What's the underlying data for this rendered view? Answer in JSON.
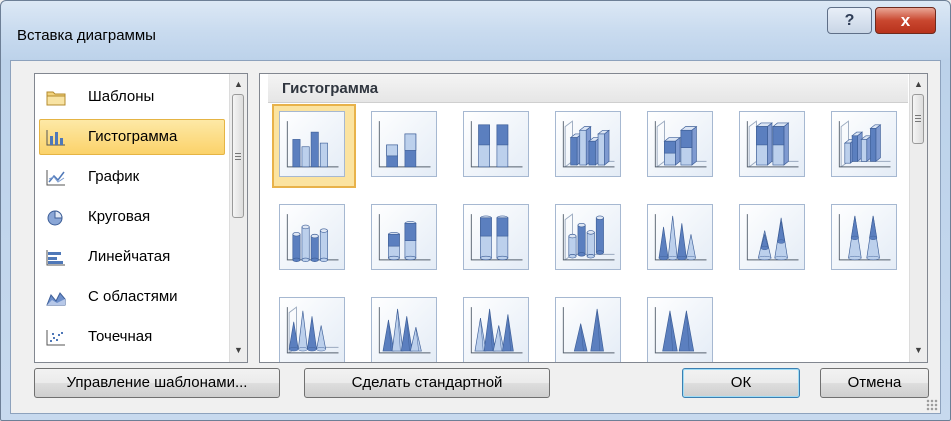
{
  "window": {
    "title": "Вставка диаграммы",
    "help_label": "?",
    "close_label": "x"
  },
  "categories": [
    {
      "label": "Шаблоны",
      "icon": "folder-icon",
      "selected": false
    },
    {
      "label": "Гистограмма",
      "icon": "column-chart-icon",
      "selected": true
    },
    {
      "label": "График",
      "icon": "line-chart-icon",
      "selected": false
    },
    {
      "label": "Круговая",
      "icon": "pie-chart-icon",
      "selected": false
    },
    {
      "label": "Линейчатая",
      "icon": "bar-chart-icon",
      "selected": false
    },
    {
      "label": "С областями",
      "icon": "area-chart-icon",
      "selected": false
    },
    {
      "label": "Точечная",
      "icon": "scatter-chart-icon",
      "selected": false
    }
  ],
  "gallery": {
    "section_title": "Гистограмма",
    "thumbnails": [
      {
        "icon": "clustered-column-icon",
        "selected": true
      },
      {
        "icon": "stacked-column-icon"
      },
      {
        "icon": "100-stacked-column-icon"
      },
      {
        "icon": "3d-clustered-column-icon"
      },
      {
        "icon": "3d-stacked-column-icon"
      },
      {
        "icon": "3d-100-stacked-column-icon"
      },
      {
        "icon": "3d-column-icon"
      },
      {
        "icon": "clustered-cylinder-icon"
      },
      {
        "icon": "stacked-cylinder-icon"
      },
      {
        "icon": "100-stacked-cylinder-icon"
      },
      {
        "icon": "3d-cylinder-icon"
      },
      {
        "icon": "clustered-cone-icon"
      },
      {
        "icon": "stacked-cone-icon"
      },
      {
        "icon": "100-stacked-cone-icon"
      },
      {
        "icon": "3d-cone-icon"
      },
      {
        "icon": "clustered-pyramid-icon"
      },
      {
        "icon": "stacked-pyramid-icon"
      },
      {
        "icon": "100-stacked-pyramid-icon"
      },
      {
        "icon": "3d-pyramid-icon"
      }
    ]
  },
  "buttons": {
    "manage_templates": "Управление шаблонами...",
    "set_default": "Сделать стандартной",
    "ok": "ОК",
    "cancel": "Отмена"
  },
  "colors": {
    "accent_selection": "#fbd26a",
    "column_blue": "#5b7fbf",
    "column_light": "#bcd0ec"
  }
}
